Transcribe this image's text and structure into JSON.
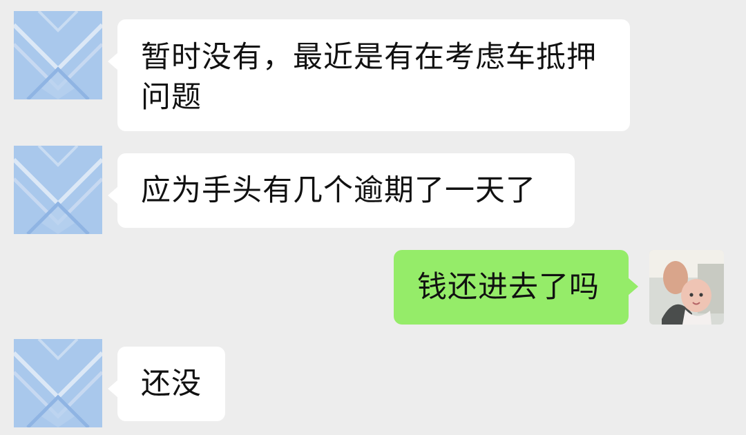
{
  "messages": [
    {
      "side": "left",
      "text": "暂时没有，最近是有在考虑车抵押问题",
      "lines": [
        "暂时没有，最近是有在考虑车抵押",
        "问题"
      ]
    },
    {
      "side": "left",
      "text": "应为手头有几个逾期了一天了"
    },
    {
      "side": "right",
      "text": "钱还进去了吗"
    },
    {
      "side": "left",
      "text": "还没"
    }
  ],
  "colors": {
    "background": "#ededed",
    "incoming_bubble": "#ffffff",
    "outgoing_bubble": "#95ec69",
    "text": "#111111"
  },
  "avatars": {
    "contact": "geometric-blue-pattern-avatar",
    "self": "man-and-baby-photo-avatar"
  }
}
